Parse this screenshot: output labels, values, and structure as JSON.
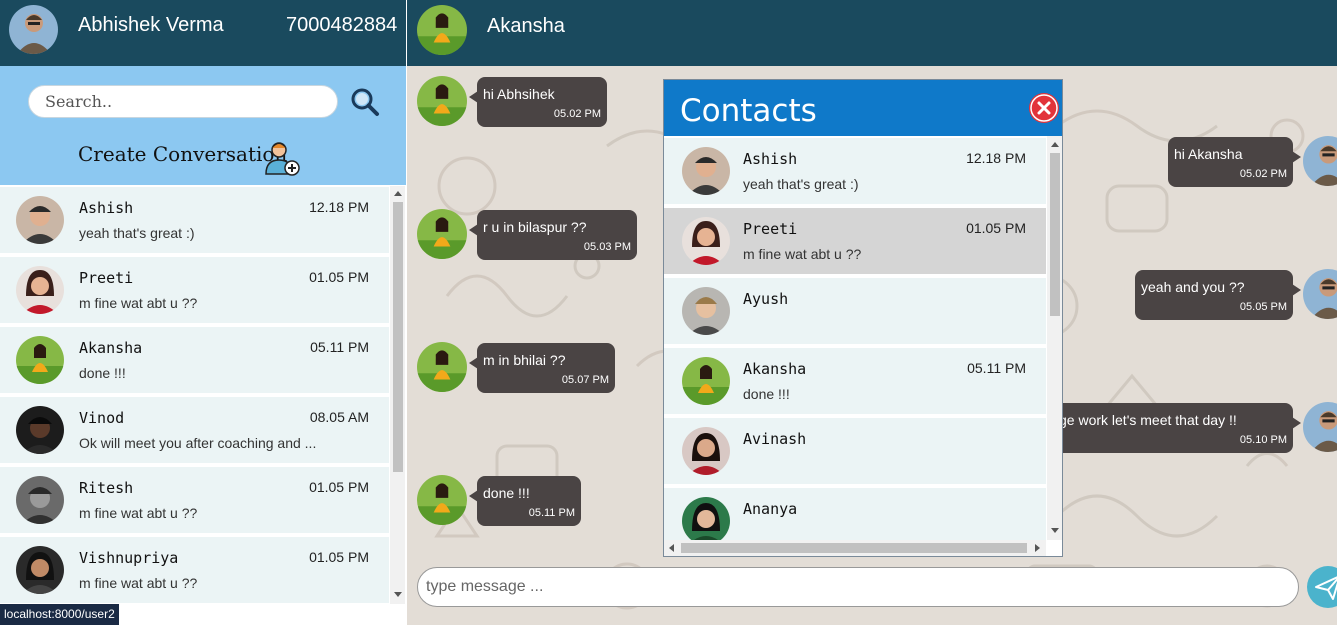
{
  "user": {
    "name": "Abhishek Verma",
    "phone": "7000482884"
  },
  "search": {
    "placeholder": "Search.."
  },
  "create_label": "Create Conversation",
  "conversations": [
    {
      "name": "Ashish",
      "time": "12.18 PM",
      "message": "yeah that's great :)"
    },
    {
      "name": "Preeti",
      "time": "01.05 PM",
      "message": "m fine wat abt u ??"
    },
    {
      "name": "Akansha",
      "time": "05.11 PM",
      "message": "done !!!"
    },
    {
      "name": "Vinod",
      "time": "08.05 AM",
      "message": "Ok will meet you after coaching and ..."
    },
    {
      "name": "Ritesh",
      "time": "01.05 PM",
      "message": "m fine wat abt u ??"
    },
    {
      "name": "Vishnupriya",
      "time": "01.05 PM",
      "message": "m fine wat abt u ??"
    }
  ],
  "status_url": "localhost:8000/user2",
  "chat": {
    "contact_name": "Akansha",
    "messages": [
      {
        "direction": "in",
        "text": "hi Abhsihek",
        "time": "05.02 PM"
      },
      {
        "direction": "out",
        "text": "hi Akansha",
        "time": "05.02 PM"
      },
      {
        "direction": "in",
        "text": "r u in bilaspur ??",
        "time": "05.03 PM"
      },
      {
        "direction": "out",
        "text": "yeah and you ??",
        "time": "05.05 PM"
      },
      {
        "direction": "in",
        "text": "m in bhilai ??",
        "time": "05.07 PM"
      },
      {
        "direction": "out",
        "text": "ge work let's meet that day !!",
        "time": "05.10 PM"
      },
      {
        "direction": "in",
        "text": "done !!!",
        "time": "05.11 PM"
      }
    ],
    "input_placeholder": "type message ..."
  },
  "contacts_modal": {
    "title": "Contacts",
    "contacts": [
      {
        "name": "Ashish",
        "time": "12.18 PM",
        "message": "yeah that's great :)"
      },
      {
        "name": "Preeti",
        "time": "01.05 PM",
        "message": "m fine wat abt u ??",
        "selected": true
      },
      {
        "name": "Ayush",
        "time": "",
        "message": ""
      },
      {
        "name": "Akansha",
        "time": "05.11 PM",
        "message": "done !!!"
      },
      {
        "name": "Avinash",
        "time": "",
        "message": ""
      },
      {
        "name": "Ananya",
        "time": "",
        "message": ""
      }
    ]
  },
  "colors": {
    "header_bg": "#1a4a5e",
    "search_panel_bg": "#8cc8f1",
    "list_item_bg": "#ebf4f5",
    "bubble_bg": "#4a4444",
    "modal_header_bg": "#0f79c9",
    "close_button": "#e2343b",
    "send_button": "#4bb3cc"
  },
  "icons": [
    "search-icon",
    "add-user-icon",
    "close-icon",
    "send-icon"
  ]
}
